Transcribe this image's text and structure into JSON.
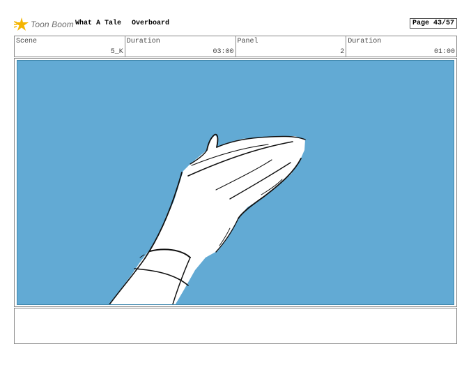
{
  "header": {
    "logo_text": "Toon Boom",
    "project_title": "What A Tale",
    "episode_title": "Overboard",
    "page_label": "Page 43/57"
  },
  "info": {
    "scene_label": "Scene",
    "scene_value": "5_K",
    "scene_duration_label": "Duration",
    "scene_duration_value": "03:00",
    "panel_label": "Panel",
    "panel_value": "2",
    "panel_duration_label": "Duration",
    "panel_duration_value": "01:00"
  },
  "panel": {
    "background_color": "#62aad4",
    "drawing": "hand-sketch"
  },
  "notes": {
    "text": ""
  }
}
